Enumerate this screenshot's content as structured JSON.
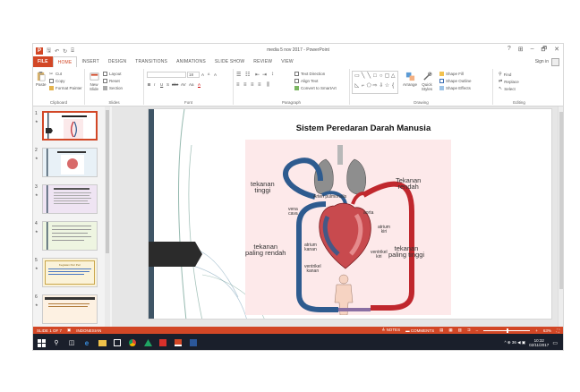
{
  "titlebar": {
    "app_letter": "P",
    "qat_save": "🖫",
    "qat_undo": "↶",
    "qat_redo": "↻",
    "qat_start": "⌸",
    "title": "media 5 nov 2017 - PowerPoint",
    "help": "?",
    "ribbon_opts": "⊞",
    "minimize": "–",
    "restore": "🗗",
    "close": "✕"
  },
  "tabs": [
    "FILE",
    "HOME",
    "INSERT",
    "DESIGN",
    "TRANSITIONS",
    "ANIMATIONS",
    "SLIDE SHOW",
    "REVIEW",
    "VIEW"
  ],
  "signin": "Sign in",
  "ribbon": {
    "clipboard": {
      "paste": "Paste",
      "cut": "Cut",
      "copy": "Copy",
      "format_painter": "Format Painter",
      "label": "Clipboard"
    },
    "slides": {
      "new_slide": "New Slide",
      "layout": "Layout",
      "reset": "Reset",
      "section": "Section",
      "label": "Slides"
    },
    "font": {
      "font_size": "18",
      "bold": "B",
      "italic": "I",
      "underline": "U",
      "strike": "S",
      "shadow": "abc",
      "spacing": "AV",
      "case": "Aa",
      "color": "A",
      "grow": "A",
      "shrink": "A",
      "clear": "A",
      "label": "Font"
    },
    "paragraph": {
      "text_direction": "Text Direction",
      "align_text": "Align Text",
      "smartart": "Convert to SmartArt",
      "label": "Paragraph"
    },
    "drawing": {
      "arrange": "Arrange",
      "quick_styles": "Quick Styles",
      "shape_fill": "Shape Fill",
      "shape_outline": "Shape Outline",
      "shape_effects": "Shape Effects",
      "label": "Drawing"
    },
    "editing": {
      "find": "Find",
      "replace": "Replace",
      "select": "Select",
      "label": "Editing"
    }
  },
  "thumbnails": [
    {
      "num": "1",
      "star": "★",
      "selected": true
    },
    {
      "num": "2",
      "star": "★",
      "selected": false
    },
    {
      "num": "3",
      "star": "★",
      "selected": false
    },
    {
      "num": "4",
      "star": "★",
      "selected": false
    },
    {
      "num": "5",
      "star": "★",
      "selected": false
    },
    {
      "num": "6",
      "star": "★",
      "selected": false
    }
  ],
  "thumb5_title": "Kegiatan Peri Peri",
  "slide": {
    "title": "Sistem Peredaran Darah Manusia",
    "labels": {
      "tekanan_tinggi_l1": "tekanan",
      "tekanan_tinggi_l2": "tinggi",
      "tekanan_rendah_l1": "Tekanan",
      "tekanan_rendah_l2": "rendah",
      "arteri_pulmonalis": "Arteri pulmonalis",
      "vena_cava_l1": "vena",
      "vena_cava_l2": "cava",
      "aorta": "aorta",
      "atrium_kiri_l1": "atrium",
      "atrium_kiri_l2": "kiri",
      "atrium_kanan_l1": "atrium",
      "atrium_kanan_l2": "kanan",
      "ventrikel_kiri_l1": "ventrikel",
      "ventrikel_kiri_l2": "kiri",
      "ventrikel_kanan_l1": "ventrikel",
      "ventrikel_kanan_l2": "kanan",
      "tekanan_pr_l1": "tekanan",
      "tekanan_pr_l2": "paling rendah",
      "tekanan_pt_l1": "tekanan",
      "tekanan_pt_l2": "paling tinggi"
    }
  },
  "statusbar": {
    "slide_of": "SLIDE 1 OF 7",
    "language": "INDONESIAN",
    "notes": "NOTES",
    "comments": "COMMENTS",
    "zoom": "63%"
  },
  "taskbar": {
    "time": "10:32",
    "date": "02/11/2017",
    "tray_text": "^ ⊕ 36 ◀ ▣"
  },
  "colors": {
    "accent": "#d24726",
    "taskbar": "#1a1f2b",
    "artery": "#c0272d",
    "vein": "#2e5b8f"
  }
}
